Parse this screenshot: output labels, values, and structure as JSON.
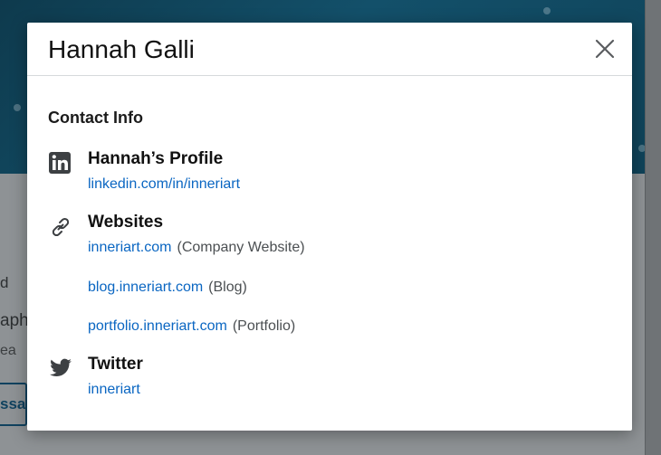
{
  "background": {
    "fragment_1": "d",
    "fragment_2": "aph",
    "fragment_3": "ea",
    "button_fragment": "ssag"
  },
  "modal": {
    "title": "Hannah Galli",
    "close_icon": "close-icon",
    "section_heading": "Contact Info",
    "profile": {
      "icon": "linkedin-icon",
      "title": "Hannah’s Profile",
      "link": "linkedin.com/in/inneriart"
    },
    "websites": {
      "icon": "link-icon",
      "title": "Websites",
      "items": [
        {
          "url": "inneriart.com",
          "label": "(Company Website)"
        },
        {
          "url": "blog.inneriart.com",
          "label": "(Blog)"
        },
        {
          "url": "portfolio.inneriart.com",
          "label": "(Portfolio)"
        }
      ]
    },
    "twitter": {
      "icon": "twitter-icon",
      "title": "Twitter",
      "handle": "inneriart"
    }
  },
  "colors": {
    "link": "#0a66c2",
    "header_bg": "#13506a"
  }
}
